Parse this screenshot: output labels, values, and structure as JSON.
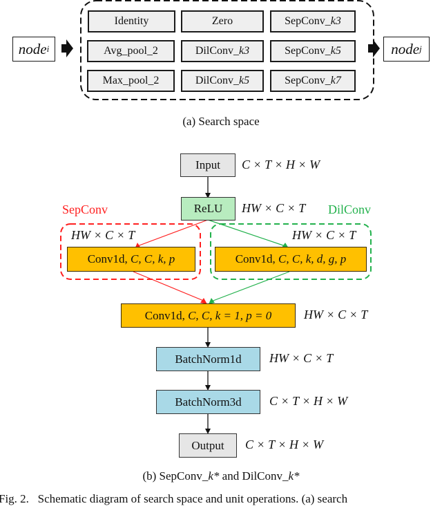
{
  "panel_a": {
    "node_in": {
      "base": "node",
      "sub": "i"
    },
    "node_out": {
      "base": "node",
      "sub": "j"
    },
    "operations": [
      {
        "name": "Identity",
        "suffix": ""
      },
      {
        "name": "Zero",
        "suffix": ""
      },
      {
        "name": "SepConv_",
        "suffix": "k3"
      },
      {
        "name": "Avg_pool_2",
        "suffix": ""
      },
      {
        "name": "DilConv_",
        "suffix": "k3"
      },
      {
        "name": "SepConv_",
        "suffix": "k5"
      },
      {
        "name": "Max_pool_2",
        "suffix": ""
      },
      {
        "name": "DilConv_",
        "suffix": "k5"
      },
      {
        "name": "SepConv_",
        "suffix": "k7"
      }
    ],
    "caption": "(a) Search space"
  },
  "panel_b": {
    "input": {
      "label": "Input",
      "dim": "C × T × H × W"
    },
    "relu": {
      "label": "ReLU",
      "dim": "HW × C × T"
    },
    "sepconv": {
      "title": "SepConv",
      "dim": "HW × C × T",
      "conv_prefix": "Conv1d, ",
      "conv_params": "C, C, k, p",
      "color": "#ff2020"
    },
    "dilconv": {
      "title": "DilConv",
      "dim": "HW × C × T",
      "conv_prefix": "Conv1d, ",
      "conv_params": "C, C, k, d, g, p",
      "color": "#22b14c"
    },
    "pointwise": {
      "prefix": "Conv1d, ",
      "params": "C, C, k = 1, p = 0",
      "dim": "HW × C × T"
    },
    "bn1d": {
      "label": "BatchNorm1d",
      "dim": "HW × C × T"
    },
    "bn3d": {
      "label": "BatchNorm3d",
      "dim": "C × T × H × W"
    },
    "output": {
      "label": "Output",
      "dim": "C × T × H × W"
    },
    "caption_prefix": "(b) SepConv_",
    "caption_k1": "k*",
    "caption_mid": " and DilConv_",
    "caption_k2": "k*"
  },
  "figure_caption": "Fig. 2.   Schematic diagram of search space and unit operations. (a) search"
}
